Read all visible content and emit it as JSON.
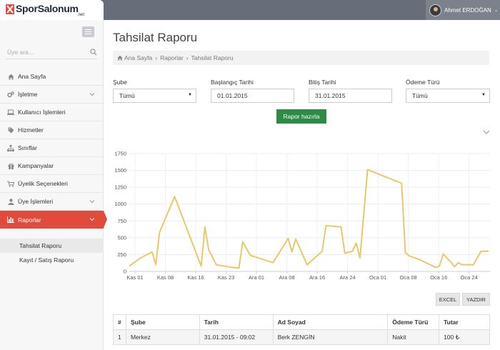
{
  "brand": {
    "name": "SporSalonum",
    "suffix": ".net",
    "color": "#e04b3c"
  },
  "user": {
    "name": "Ahmet ERDOĞAN"
  },
  "sidebar": {
    "search_placeholder": "Üye ara...",
    "items": [
      {
        "label": "Ana Sayfa",
        "icon": "home-icon"
      },
      {
        "label": "İşletme",
        "icon": "cogs-icon",
        "expandable": true
      },
      {
        "label": "Kullanıcı İşlemleri",
        "icon": "laptop-icon"
      },
      {
        "label": "Hizmetler",
        "icon": "tag-icon"
      },
      {
        "label": "Sınıflar",
        "icon": "sitemap-icon"
      },
      {
        "label": "Kampanyalar",
        "icon": "gift-icon"
      },
      {
        "label": "Üyelik Seçenekleri",
        "icon": "cart-icon"
      },
      {
        "label": "Üye İşlemleri",
        "icon": "user-icon",
        "expandable": true
      },
      {
        "label": "Raporlar",
        "icon": "bar-chart-icon",
        "expandable": true,
        "active": true
      }
    ],
    "subitems": [
      {
        "label": "Tahsilat Raporu",
        "active": true
      },
      {
        "label": "Kayıt / Satış Raporu"
      }
    ]
  },
  "page": {
    "title": "Tahsilat Raporu",
    "breadcrumb": [
      "Ana Sayfa",
      "Raporlar",
      "Tahsilat Raporu"
    ]
  },
  "filters": {
    "branch": {
      "label": "Şube",
      "value": "Tümü"
    },
    "start": {
      "label": "Başlangıç Tarihi",
      "value": "01.01.2015"
    },
    "end": {
      "label": "Bitiş Tarihi",
      "value": "31.01.2015"
    },
    "payment": {
      "label": "Ödeme Türü",
      "value": "Tümü"
    },
    "submit": "Rapor hazırla"
  },
  "actions": {
    "excel": "EXCEL",
    "print": "YAZDIR"
  },
  "table": {
    "headers": [
      "#",
      "Şube",
      "Tarih",
      "Ad Soyad",
      "Ödeme Türü",
      "Tutar"
    ],
    "rows": [
      [
        "1",
        "Merkez",
        "31.01.2015 - 09:02",
        "Berk ZENGİN",
        "Nakit",
        "100 ₺"
      ]
    ]
  },
  "chart_data": {
    "type": "line",
    "color": "#e8c86a",
    "x_tick_labels": [
      "Kas 01",
      "Kas 08",
      "Kas 16",
      "Kas 23",
      "Ara 01",
      "Ara 08",
      "Ara 16",
      "Ara 24",
      "Oca 01",
      "Oca 08",
      "Oca 16",
      "Oca 24"
    ],
    "y_ticks": [
      0,
      250,
      500,
      750,
      1000,
      1250,
      1500,
      1750
    ],
    "ylim": [
      0,
      1750
    ],
    "xlim": [
      0,
      88
    ],
    "grid": true,
    "series": [
      {
        "points": [
          [
            0,
            80
          ],
          [
            3,
            200
          ],
          [
            6,
            290
          ],
          [
            7,
            100
          ],
          [
            8,
            580
          ],
          [
            12,
            1110
          ],
          [
            19,
            80
          ],
          [
            20,
            660
          ],
          [
            21,
            320
          ],
          [
            23,
            100
          ],
          [
            27,
            60
          ],
          [
            29,
            50
          ],
          [
            30,
            440
          ],
          [
            32,
            240
          ],
          [
            38,
            130
          ],
          [
            42,
            490
          ],
          [
            43,
            290
          ],
          [
            44,
            480
          ],
          [
            47,
            100
          ],
          [
            51,
            300
          ],
          [
            52,
            680
          ],
          [
            56,
            660
          ],
          [
            57,
            270
          ],
          [
            59,
            300
          ],
          [
            60,
            420
          ],
          [
            61,
            200
          ],
          [
            63,
            1510
          ],
          [
            72,
            1310
          ],
          [
            73,
            280
          ],
          [
            74,
            230
          ],
          [
            77,
            170
          ],
          [
            81,
            60
          ],
          [
            82,
            80
          ],
          [
            83,
            260
          ],
          [
            85,
            140
          ],
          [
            86,
            70
          ],
          [
            87,
            130
          ],
          [
            88,
            100
          ],
          [
            89,
            100
          ],
          [
            91,
            100
          ],
          [
            93,
            300
          ],
          [
            95,
            300
          ]
        ]
      }
    ]
  }
}
